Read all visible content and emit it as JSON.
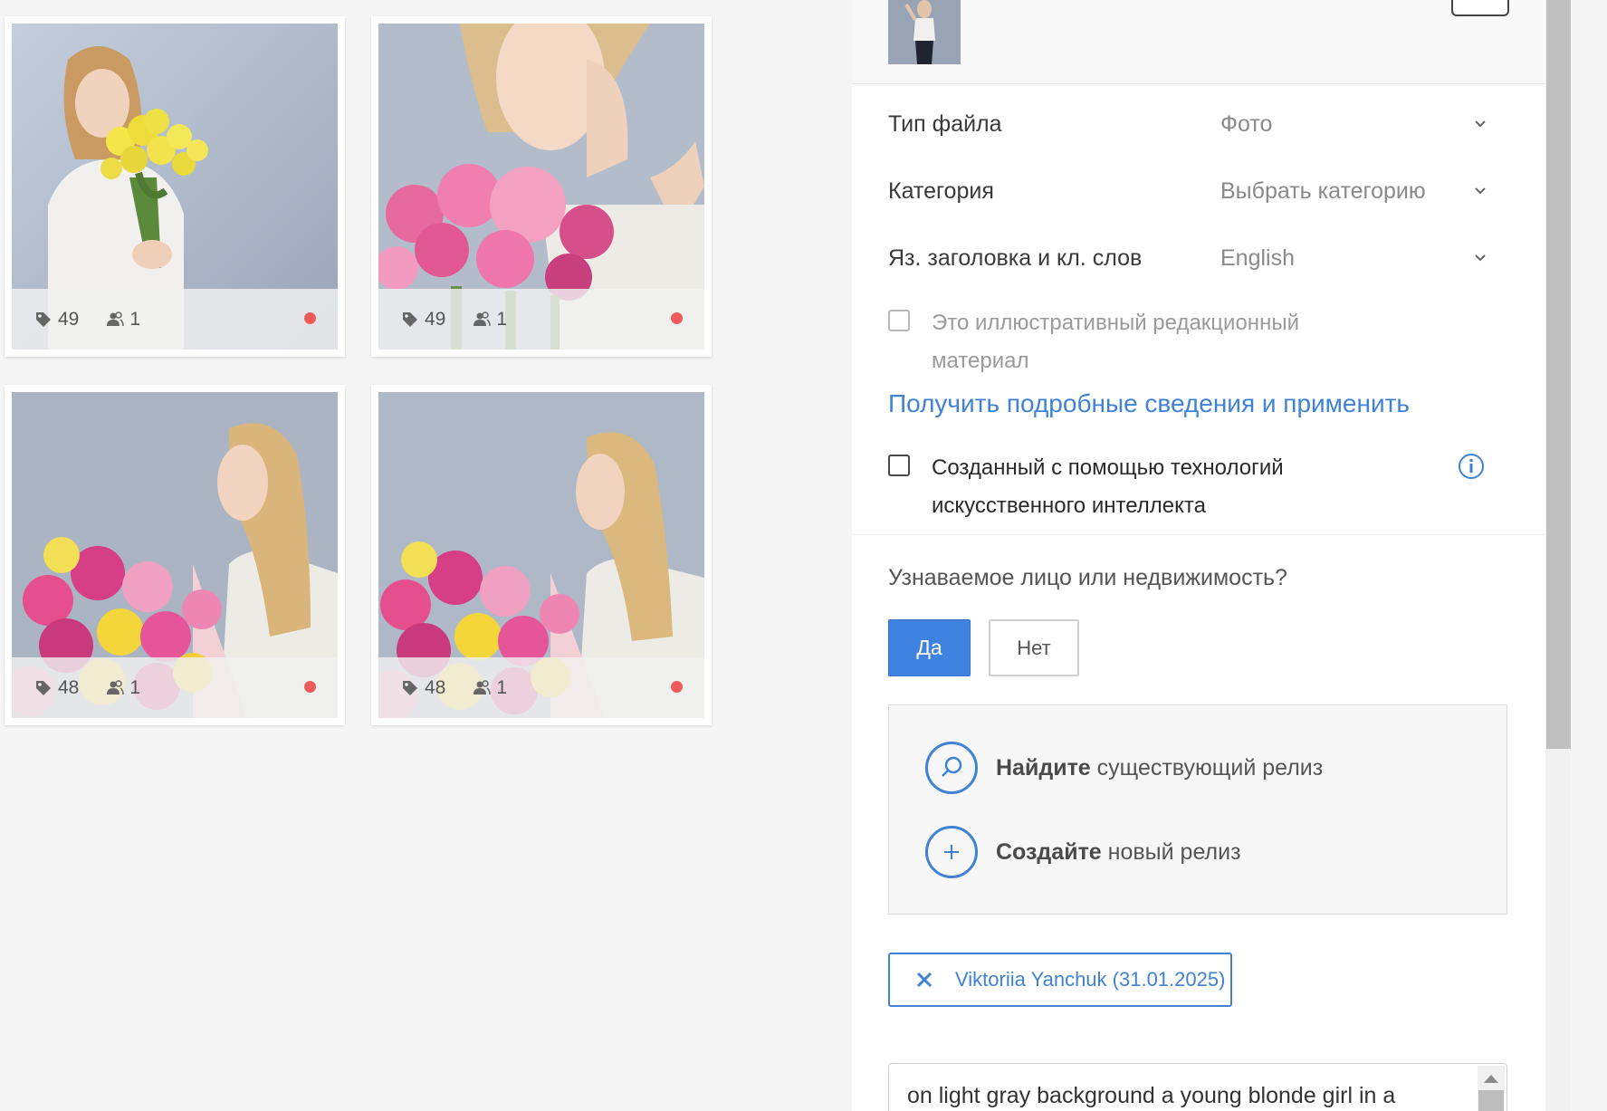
{
  "cards": [
    {
      "keywords": "49",
      "people": "1",
      "status_color": "#ef5b5b"
    },
    {
      "keywords": "49",
      "people": "1",
      "status_color": "#ef5b5b"
    },
    {
      "keywords": "48",
      "people": "1",
      "status_color": "#ef5b5b"
    },
    {
      "keywords": "48",
      "people": "1",
      "status_color": "#ef5b5b"
    }
  ],
  "panel": {
    "file_type": {
      "label": "Тип файла",
      "value": "Фото"
    },
    "category": {
      "label": "Категория",
      "value": "Выбрать категорию"
    },
    "language": {
      "label": "Яз. заголовка и кл. слов",
      "value": "English"
    },
    "editorial_checkbox": "Это иллюстративный редакционный материал",
    "details_link": "Получить подробные сведения и применить",
    "ai_checkbox": "Созданный с помощью технологий искусственного интеллекта",
    "question": "Узнаваемое лицо или недвижимость?",
    "yes_label": "Да",
    "no_label": "Нет",
    "find_release_bold": "Найдите",
    "find_release_rest": " существующий релиз",
    "create_release_bold": "Создайте",
    "create_release_rest": " новый релиз",
    "release_chip": "Viktoriia Yanchuk (31.01.2025)",
    "title_text": "on light gray background a young blonde girl in a"
  },
  "colors": {
    "accent": "#3f82d6",
    "status_dot": "#ef5b5b"
  },
  "icons": {
    "keywords": "tag-icon",
    "people": "people-icon",
    "dropdown": "chevron-down-icon",
    "info": "info-icon",
    "find": "search-icon",
    "create": "plus-icon",
    "remove": "close-icon"
  }
}
